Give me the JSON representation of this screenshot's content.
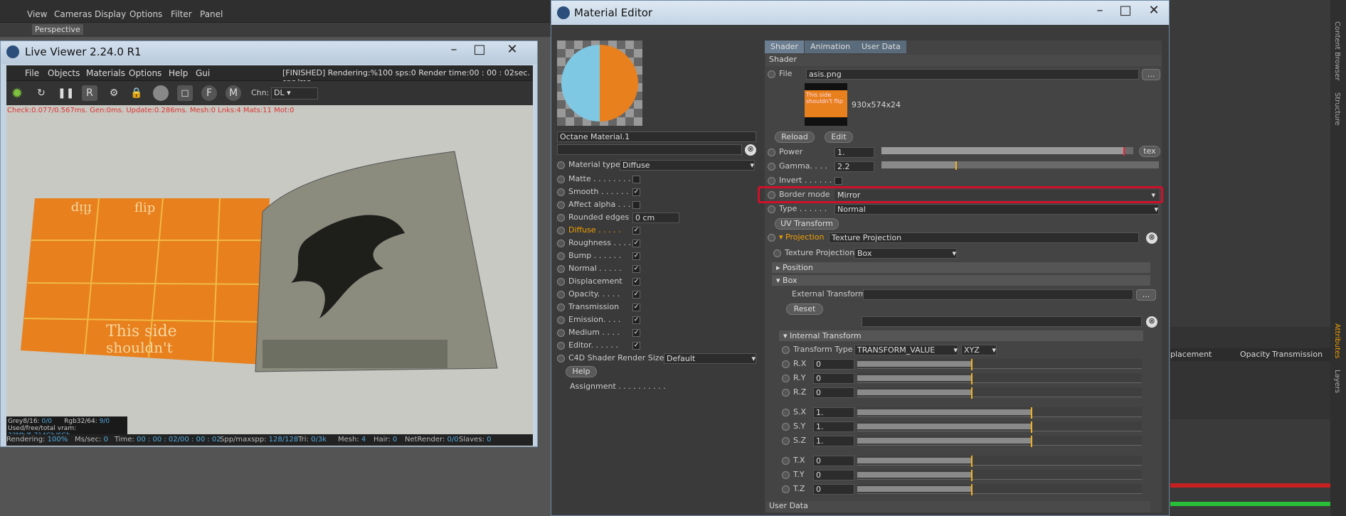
{
  "c4d_menu": [
    "View",
    "Cameras",
    "Display",
    "Options",
    "Filter",
    "Panel"
  ],
  "viewport_label": "Perspective",
  "live_viewer": {
    "title": "Live Viewer 2.24.0 R1",
    "menu": [
      "File",
      "Objects",
      "Materials",
      "Options",
      "Help",
      "Gui"
    ],
    "status_text": "[FINISHED]  Rendering:%100 sps:0 Render time:00 : 00 : 02sec. spp/ma",
    "chn_label": "Chn:",
    "chn_value": "DL",
    "debug_line": "Check:0.077/0.567ms. Gen:0ms. Update:0.286ms. Mesh:0 Lnks:4 Mats:11 Mot:0",
    "grey": "Grey8/16:",
    "grey_val": "0/0",
    "rgb": "Rgb32/64:",
    "rgb_val": "9/0",
    "vram": "Used/free/total vram:",
    "vram_val": "33Mb/5.714Gb/6Gb",
    "bottom_status": [
      {
        "label": "Rendering:",
        "value": "100%"
      },
      {
        "label": "Ms/sec:",
        "value": "0"
      },
      {
        "label": "Time:",
        "value": "00 : 00 : 02/00 : 00 : 02"
      },
      {
        "label": "Spp/maxspp:",
        "value": "128/128"
      },
      {
        "label": "Tri:",
        "value": "0/3k"
      },
      {
        "label": "Mesh:",
        "value": "4"
      },
      {
        "label": "Hair:",
        "value": "0"
      },
      {
        "label": "NetRender:",
        "value": "0/0"
      },
      {
        "label": "Slaves:",
        "value": "0"
      }
    ],
    "texture_words": [
      "This side",
      "shouldn't",
      "flip"
    ]
  },
  "material_editor": {
    "title": "Material Editor",
    "material_name": "Octane Material.1",
    "material_type_label": "Material type",
    "material_type_value": "Diffuse",
    "channels": [
      {
        "label": "Matte . . . . . . . .",
        "checked": false
      },
      {
        "label": "Smooth  . . . . . .",
        "checked": true
      },
      {
        "label": "Affect alpha . . .",
        "checked": false
      },
      {
        "label": "Rounded edges",
        "value": "0 cm"
      },
      {
        "label": "Diffuse . . . . .",
        "checked": true,
        "active": true
      },
      {
        "label": "Roughness . . . .",
        "checked": true
      },
      {
        "label": "Bump . . . . . .",
        "checked": true
      },
      {
        "label": "Normal . . . . .",
        "checked": true
      },
      {
        "label": "Displacement",
        "checked": true
      },
      {
        "label": "Opacity. . . . .",
        "checked": true
      },
      {
        "label": "Transmission",
        "checked": true
      },
      {
        "label": "Emission. . . .",
        "checked": true
      },
      {
        "label": "Medium . . . .",
        "checked": true
      },
      {
        "label": "Editor. . . . . .",
        "checked": true
      }
    ],
    "c4d_shader_label": "C4D Shader Render Size",
    "c4d_shader_value": "Default",
    "help_btn": "Help",
    "assignment": "Assignment . . . . . . . . . .",
    "tabs": [
      "Shader",
      "Animation",
      "User Data"
    ],
    "section_shader": "Shader",
    "file_label": "File",
    "file_value": "asis.png",
    "file_btn": "...",
    "thumb_text": "This side shouldn't flip",
    "image_size": "930x574x24",
    "reload_btn": "Reload",
    "edit_btn": "Edit",
    "power_label": "Power",
    "power_value": "1.",
    "tex_btn": "tex",
    "gamma_label": "Gamma. . . .",
    "gamma_value": "2.2",
    "invert_label": "Invert . . . . . .",
    "border_mode_label": "Border mode",
    "border_mode_value": "Mirror",
    "type_label": "Type . . . . . .",
    "type_value": "Normal",
    "uv_transform_btn": "UV Transform",
    "projection_label": "Projection",
    "projection_value": "Texture Projection",
    "texture_projection_label": "Texture Projection",
    "texture_projection_value": "Box",
    "position_label": "Position",
    "box_label": "Box",
    "external_transform_label": "External Transform",
    "ext_btn": "...",
    "reset_btn": "Reset",
    "internal_transform_label": "Internal Transform",
    "transform_type_label": "Transform Type",
    "transform_type_value": "TRANSFORM_VALUE",
    "order_value": "XYZ",
    "params": [
      {
        "label": "R.X",
        "value": "0"
      },
      {
        "label": "R.Y",
        "value": "0"
      },
      {
        "label": "R.Z",
        "value": "0"
      },
      {
        "label": "S.X",
        "value": "1."
      },
      {
        "label": "S.Y",
        "value": "1."
      },
      {
        "label": "S.Z",
        "value": "1."
      },
      {
        "label": "T.X",
        "value": "0"
      },
      {
        "label": "T.Y",
        "value": "0"
      },
      {
        "label": "T.Z",
        "value": "0"
      }
    ],
    "user_data_label": "User Data"
  },
  "right_side": {
    "columns": [
      "placement",
      "Opacity",
      "Transmission"
    ],
    "side_tabs": [
      "Content Browser",
      "Structure",
      "Attributes",
      "Layers"
    ]
  }
}
